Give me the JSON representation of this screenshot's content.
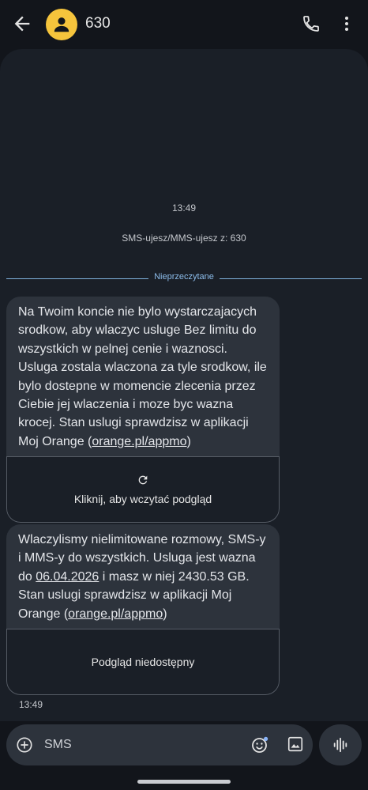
{
  "header": {
    "contact_name": "630"
  },
  "thread": {
    "date_time": "13:49",
    "sms_info": "SMS-ujesz/MMS-ujesz z: 630",
    "unread_label": "Nieprzeczytane",
    "messages": [
      {
        "text_before": "Na Twoim koncie nie bylo wystarczajacych srodkow, aby wlaczyc usluge Bez limitu do wszystkich w pelnej cenie i waznosci. Usluga zostala wlaczona za tyle srodkow, ile bylo dostepne w momencie zlecenia przez Ciebie jej wlaczenia i moze byc wazna krocej. Stan uslugi sprawdzisz w aplikacji Moj Orange (",
        "link": "orange.pl/appmo",
        "text_after": ")",
        "preview_label": "Kliknij, aby wczytać podgląd"
      },
      {
        "text_part1": "Wlaczylismy nielimitowane rozmowy, SMS-y i MMS-y do wszystkich. Usluga jest wazna do ",
        "date_link": "06.04.2026",
        "text_part2": " i masz w niej 2430.53 GB. Stan uslugi sprawdzisz w aplikacji Moj Orange (",
        "link": "orange.pl/appmo",
        "text_after": ")",
        "preview_label": "Podgląd niedostępny"
      }
    ],
    "last_time": "13:49"
  },
  "composer": {
    "placeholder": "SMS"
  },
  "colors": {
    "background": "#12151b",
    "thread_bg": "#1a1f27",
    "bubble": "#2d333c",
    "avatar": "#f5c43c",
    "unread_accent": "#8cbcea"
  },
  "icons": [
    "arrow-back-icon",
    "person-icon",
    "phone-icon",
    "more-vert-icon",
    "refresh-icon",
    "add-circle-icon",
    "emoji-icon",
    "gallery-icon",
    "voice-icon"
  ]
}
